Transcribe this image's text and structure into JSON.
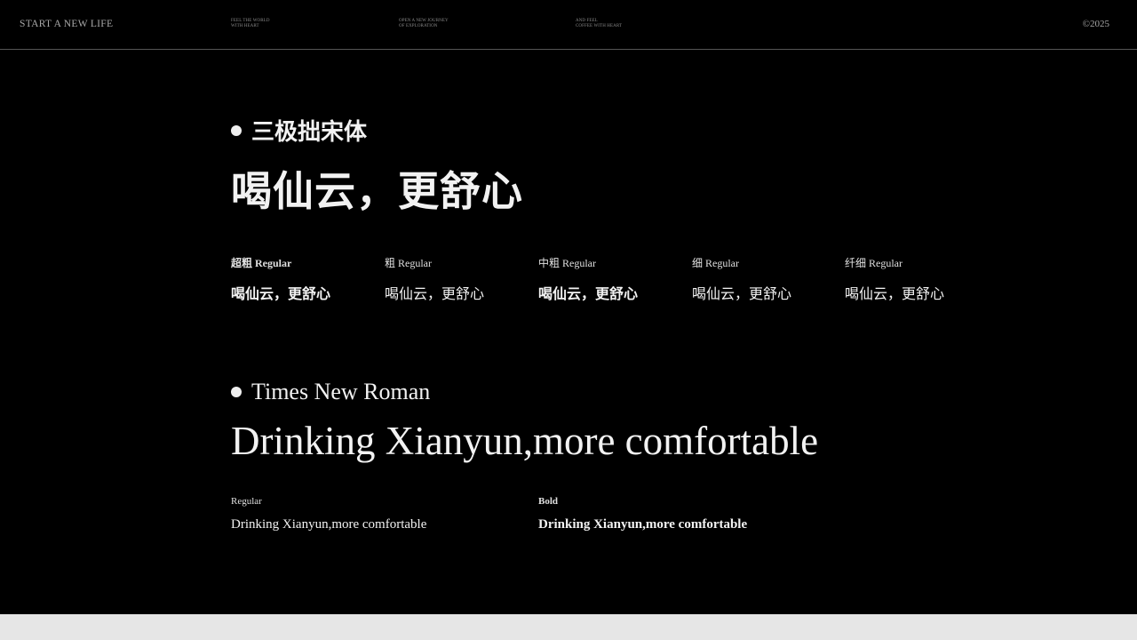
{
  "header": {
    "brand": "START A NEW LIFE",
    "nav": [
      {
        "line1": "FEEL THE WORLD",
        "line2": "WITH HEART"
      },
      {
        "line1": "OPEN A NEW JOURNEY",
        "line2": "OF EXPLORATION"
      },
      {
        "line1": "AND FEEL",
        "line2": "COFFEE WITH HEART"
      }
    ],
    "copyright": "©2025"
  },
  "chinese_font": {
    "name": "三极拙宋体",
    "display": "喝仙云，更舒心",
    "weights": [
      {
        "label": "超粗 Regular",
        "sample": "喝仙云，更舒心"
      },
      {
        "label": "粗 Regular",
        "sample": "喝仙云，更舒心"
      },
      {
        "label": "中粗 Regular",
        "sample": "喝仙云，更舒心"
      },
      {
        "label": "细 Regular",
        "sample": "喝仙云，更舒心"
      },
      {
        "label": "纤细 Regular",
        "sample": "喝仙云，更舒心"
      }
    ]
  },
  "latin_font": {
    "name": "Times New Roman",
    "display": "Drinking Xianyun,more comfortable",
    "weights": [
      {
        "label": "Regular",
        "sample": "Drinking Xianyun,more comfortable"
      },
      {
        "label": "Bold",
        "sample": "Drinking Xianyun,more comfortable"
      }
    ]
  }
}
